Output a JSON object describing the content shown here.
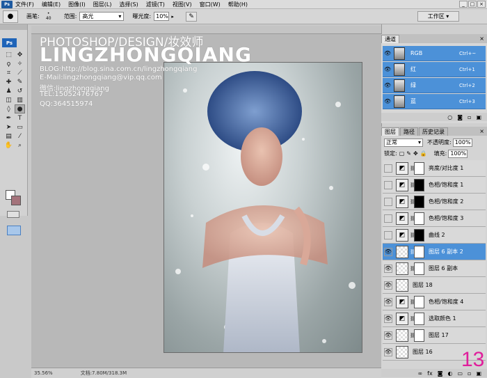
{
  "menubar": {
    "app_badge": "Ps",
    "items": [
      "文件(F)",
      "编辑(E)",
      "图像(I)",
      "图层(L)",
      "选择(S)",
      "滤镜(T)",
      "视图(V)",
      "窗口(W)",
      "帮助(H)"
    ]
  },
  "options": {
    "brush_label": "画笔:",
    "brush_size": "40",
    "range_label": "范围:",
    "range_value": "高光",
    "exposure_label": "曝光度:",
    "exposure_value": "10%",
    "workspace_label": "工作区 ▾"
  },
  "status": {
    "zoom": "35.56%",
    "doc_info": "文档:7.80M/318.3M"
  },
  "watermark": {
    "line1": "PHOTOSHOP/DESIGN/妆效师",
    "line2": "LINGZHONGQIANG",
    "blog": "BLOG:http://blog.sina.com.cn/lingzhongqiang",
    "email": "E-Mail:lingzhongqiang@vip.qq.com",
    "wechat": "微信:lingzhongqiang",
    "tel": "TEL:15052476767",
    "qq": "QQ:364515974"
  },
  "channels": {
    "tabs": [
      "通道"
    ],
    "rows": [
      {
        "name": "RGB",
        "shortcut": "Ctrl+~"
      },
      {
        "name": "红",
        "shortcut": "Ctrl+1"
      },
      {
        "name": "绿",
        "shortcut": "Ctrl+2"
      },
      {
        "name": "蓝",
        "shortcut": "Ctrl+3"
      }
    ]
  },
  "layers": {
    "tabs": [
      "图层",
      "路径",
      "历史记录"
    ],
    "blend_mode": "正常",
    "opacity_label": "不透明度:",
    "opacity_value": "100%",
    "lock_label": "锁定:",
    "fill_label": "填充:",
    "fill_value": "100%",
    "items": [
      {
        "name": "亮度/对比度 1",
        "visible": false,
        "kind": "adjust",
        "mask": "white"
      },
      {
        "name": "色相/饱和度 1",
        "visible": false,
        "kind": "adjust",
        "mask": "black"
      },
      {
        "name": "色相/饱和度 2",
        "visible": false,
        "kind": "adjust",
        "mask": "black"
      },
      {
        "name": "色相/饱和度 3",
        "visible": false,
        "kind": "adjust",
        "mask": "white"
      },
      {
        "name": "曲线 2",
        "visible": false,
        "kind": "adjust",
        "mask": "black"
      },
      {
        "name": "图层 6 副本 2",
        "visible": true,
        "kind": "pixel",
        "mask": "white",
        "selected": true
      },
      {
        "name": "图层 6 副本",
        "visible": true,
        "kind": "pixel",
        "mask": "white"
      },
      {
        "name": "图层 18",
        "visible": true,
        "kind": "pixel",
        "mask": "none"
      },
      {
        "name": "色相/饱和度 4",
        "visible": true,
        "kind": "adjust",
        "mask": "white"
      },
      {
        "name": "选取颜色 1",
        "visible": true,
        "kind": "adjust",
        "mask": "white"
      },
      {
        "name": "图层 17",
        "visible": true,
        "kind": "pixel",
        "mask": "white"
      },
      {
        "name": "图层 16",
        "visible": true,
        "kind": "pixel",
        "mask": "none"
      }
    ]
  },
  "step_number": "13",
  "colors": {
    "selection_blue": "#4c91d8",
    "step_magenta": "#e01f9c",
    "background_color": "#a4737b"
  }
}
